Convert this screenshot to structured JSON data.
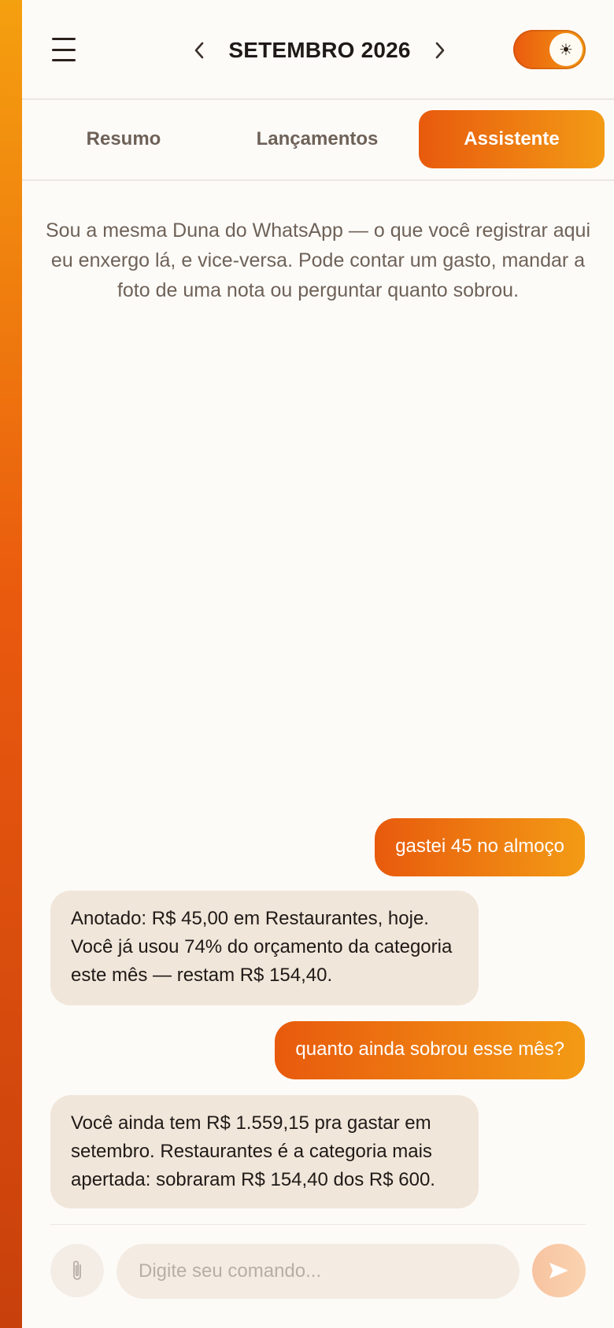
{
  "header": {
    "month_label": "SETEMBRO 2026",
    "theme_icon": "sun-icon",
    "colors": {
      "accent_start": "#e85a0d",
      "accent_end": "#f39b15"
    }
  },
  "tabs": [
    {
      "label": "Resumo",
      "active": false
    },
    {
      "label": "Lançamentos",
      "active": false
    },
    {
      "label": "Assistente",
      "active": true
    }
  ],
  "intro_text": "Sou a mesma Duna do WhatsApp — o que você registrar aqui eu enxergo lá, e vice-versa. Pode contar um gasto, mandar a foto de uma nota ou perguntar quanto sobrou.",
  "messages": [
    {
      "role": "user",
      "text": "gastei 45 no almoço"
    },
    {
      "role": "assistant",
      "text": "Anotado: R$ 45,00 em Restaurantes, hoje. Você já usou 74% do orçamento da categoria este mês — restam R$ 154,40."
    },
    {
      "role": "user",
      "text": "quanto ainda sobrou esse mês?"
    },
    {
      "role": "assistant",
      "text": "Você ainda tem R$ 1.559,15 pra gastar em setembro. Restaurantes é a categoria mais apertada: sobraram R$ 154,40 dos R$ 600."
    }
  ],
  "composer": {
    "placeholder": "Digite seu comando...",
    "value": "",
    "attach_icon": "paperclip-icon",
    "send_icon": "send-icon"
  }
}
